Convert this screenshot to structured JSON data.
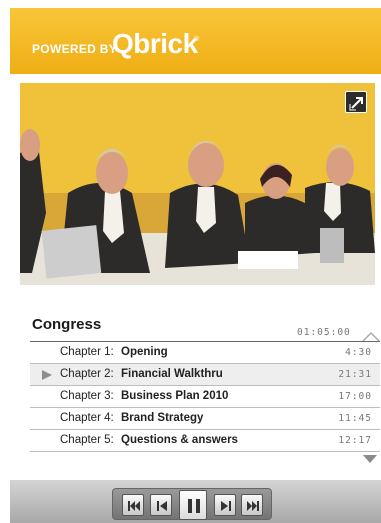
{
  "header": {
    "powered_label": "POWERED BY",
    "brand": "Qbrick",
    "brand_mark": "®",
    "brand_color": "#f5b825"
  },
  "video": {
    "thumbnail_subject": "Panel of speakers at congress table",
    "expand_icon": "fullscreen-icon"
  },
  "playlist": {
    "title": "Congress",
    "total_duration": "01:05:00",
    "chapters": [
      {
        "number": "Chapter 1:",
        "name": "Opening",
        "time": "4:30",
        "active": false
      },
      {
        "number": "Chapter 2:",
        "name": "Financial Walkthru",
        "time": "21:31",
        "active": true
      },
      {
        "number": "Chapter 3:",
        "name": "Business Plan 2010",
        "time": "17:00",
        "active": false
      },
      {
        "number": "Chapter 4:",
        "name": "Brand Strategy",
        "time": "11:45",
        "active": false
      },
      {
        "number": "Chapter 5:",
        "name": "Questions & answers",
        "time": "12:17",
        "active": false
      }
    ]
  },
  "controls": {
    "buttons": [
      "skip-back-icon",
      "step-back-icon",
      "pause-icon",
      "step-forward-icon",
      "skip-forward-icon"
    ]
  }
}
